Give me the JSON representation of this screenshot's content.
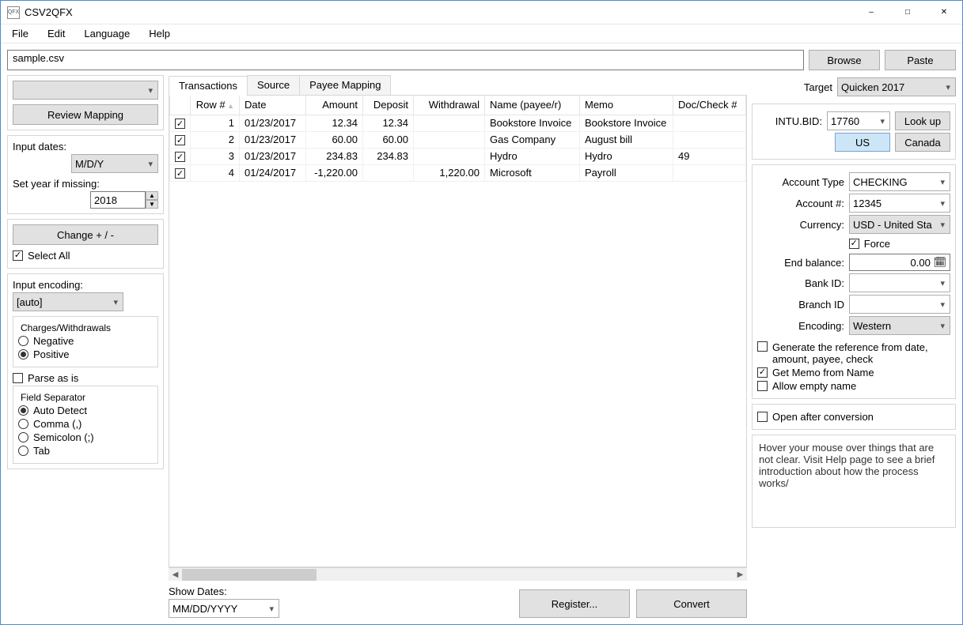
{
  "app": {
    "title": "CSV2QFX"
  },
  "menu": [
    "File",
    "Edit",
    "Language",
    "Help"
  ],
  "file": {
    "path": "sample.csv",
    "browse": "Browse",
    "paste": "Paste"
  },
  "left": {
    "review": "Review Mapping",
    "input_dates_label": "Input dates:",
    "input_dates_value": "M/D/Y",
    "set_year_label": "Set year if missing:",
    "set_year_value": "2018",
    "change": "Change + / -",
    "select_all": "Select All",
    "encoding_label": "Input encoding:",
    "encoding_value": "[auto]",
    "charges_legend": "Charges/Withdrawals",
    "charges_neg": "Negative",
    "charges_pos": "Positive",
    "parse_as_is": "Parse as is",
    "sep_legend": "Field Separator",
    "sep_auto": "Auto Detect",
    "sep_comma": "Comma (,)",
    "sep_semi": "Semicolon (;)",
    "sep_tab": "Tab"
  },
  "tabs": [
    "Transactions",
    "Source",
    "Payee Mapping"
  ],
  "cols": [
    "",
    "Row #",
    "Date",
    "Amount",
    "Deposit",
    "Withdrawal",
    "Name (payee/r)",
    "Memo",
    "Doc/Check #"
  ],
  "rows": [
    {
      "n": "1",
      "date": "01/23/2017",
      "amount": "12.34",
      "deposit": "12.34",
      "withdrawal": "",
      "name": "Bookstore Invoice",
      "memo": "Bookstore Invoice",
      "doc": ""
    },
    {
      "n": "2",
      "date": "01/23/2017",
      "amount": "60.00",
      "deposit": "60.00",
      "withdrawal": "",
      "name": "Gas Company",
      "memo": "August bill",
      "doc": ""
    },
    {
      "n": "3",
      "date": "01/23/2017",
      "amount": "234.83",
      "deposit": "234.83",
      "withdrawal": "",
      "name": "Hydro",
      "memo": "Hydro",
      "doc": "49"
    },
    {
      "n": "4",
      "date": "01/24/2017",
      "amount": "-1,220.00",
      "deposit": "",
      "withdrawal": "1,220.00",
      "name": "Microsoft",
      "memo": "Payroll",
      "doc": ""
    }
  ],
  "bottom": {
    "show_dates_label": "Show Dates:",
    "show_dates_value": "MM/DD/YYYY",
    "register": "Register...",
    "convert": "Convert"
  },
  "right": {
    "target_label": "Target",
    "target_value": "Quicken 2017",
    "intubid_label": "INTU.BID:",
    "intubid_value": "17760",
    "lookup": "Look up",
    "us": "US",
    "canada": "Canada",
    "acct_type_label": "Account Type",
    "acct_type_value": "CHECKING",
    "acct_num_label": "Account #:",
    "acct_num_value": "12345",
    "currency_label": "Currency:",
    "currency_value": "USD - United Sta",
    "force": "Force",
    "end_bal_label": "End balance:",
    "end_bal_value": "0.00",
    "bank_id_label": "Bank ID:",
    "branch_id_label": "Branch ID",
    "encoding_label": "Encoding:",
    "encoding_value": "Western",
    "gen_ref": "Generate the reference from date, amount, payee, check",
    "get_memo": "Get Memo from Name",
    "allow_empty": "Allow empty name",
    "open_after": "Open after conversion",
    "tip": "Hover your mouse over things that are not clear. Visit Help page to see a brief introduction about how the process works/"
  }
}
